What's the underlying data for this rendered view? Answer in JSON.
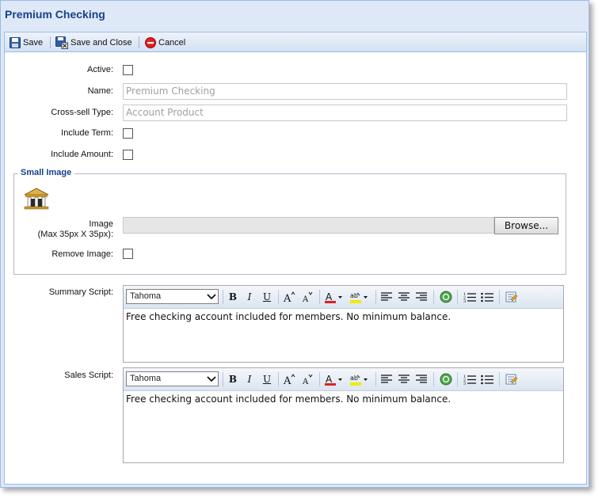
{
  "window": {
    "title": "Premium Checking"
  },
  "toolbar": {
    "save_label": "Save",
    "save_close_label": "Save and Close",
    "cancel_label": "Cancel"
  },
  "form": {
    "active_label": "Active:",
    "name_label": "Name:",
    "name_value": "Premium Checking",
    "crosssell_label": "Cross-sell Type:",
    "crosssell_value": "Account Product",
    "include_term_label": "Include Term:",
    "include_amount_label": "Include Amount:"
  },
  "small_image": {
    "legend": "Small Image",
    "image_label_line1": "Image",
    "image_label_line2": "(Max 35px X 35px):",
    "browse_label": "Browse...",
    "remove_label": "Remove Image:",
    "icon": "bank-building-icon"
  },
  "summary_script": {
    "label": "Summary Script:",
    "font": "Tahoma",
    "text": "Free checking account included for members. No minimum balance."
  },
  "sales_script": {
    "label": "Sales Script:",
    "font": "Tahoma",
    "text": "Free checking account included for members. No minimum balance."
  },
  "colors": {
    "title": "#15428b",
    "frame": "#99bbe8",
    "accent_red": "#e02020",
    "accent_yellow": "#f5e800"
  }
}
